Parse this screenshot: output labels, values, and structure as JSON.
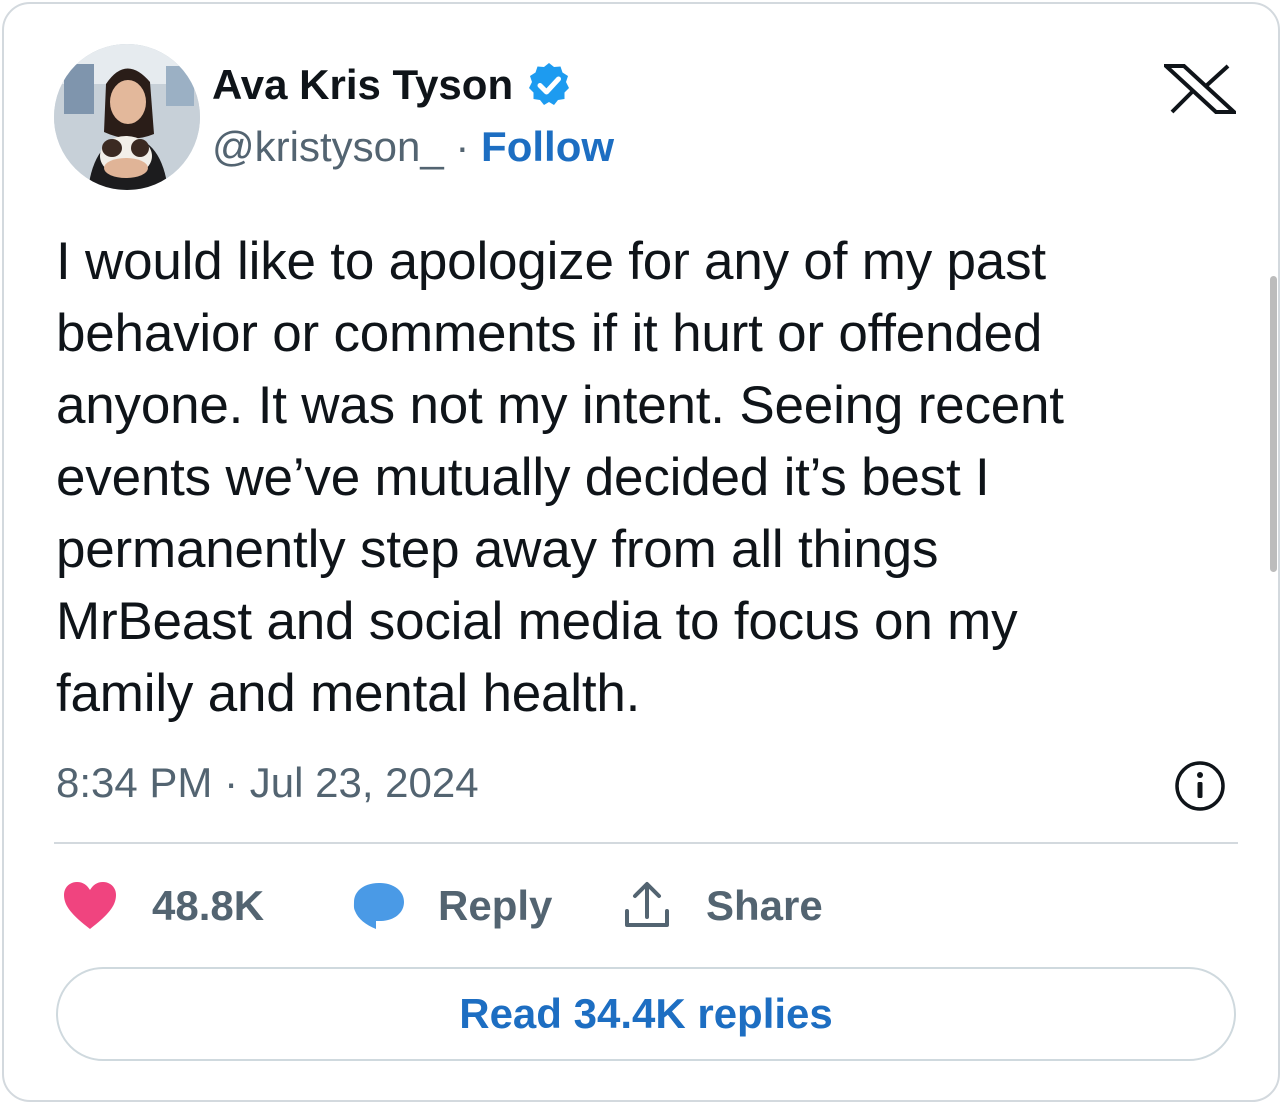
{
  "author": {
    "display_name": "Ava Kris Tyson",
    "handle": "@kristyson_",
    "separator": "·",
    "follow_label": "Follow",
    "verified": true
  },
  "tweet": {
    "lines": [
      "I would like to apologize for any of my past",
      "behavior or comments if it hurt or offended",
      "anyone. It was not my intent. Seeing recent",
      "events we’ve mutually decided it’s best I",
      "permanently step away from all things",
      "MrBeast and social media to focus on my",
      "family and mental health."
    ],
    "timestamp": "8:34 PM · Jul 23, 2024"
  },
  "actions": {
    "like_count": "48.8K",
    "reply_label": "Reply",
    "share_label": "Share"
  },
  "footer": {
    "read_replies_label": "Read 34.4K replies"
  },
  "icons": {
    "brand": "x-logo-icon",
    "verified": "verified-badge-icon",
    "info": "info-icon",
    "like": "heart-icon",
    "reply": "speech-bubble-icon",
    "share": "share-arrow-icon"
  },
  "colors": {
    "text": "#0f1419",
    "secondary": "#536471",
    "link": "#1d6ec2",
    "verified": "#1d9bf0",
    "heart": "#f0447f",
    "reply_bubble": "#4a9ae6",
    "border": "#d3d9de"
  }
}
